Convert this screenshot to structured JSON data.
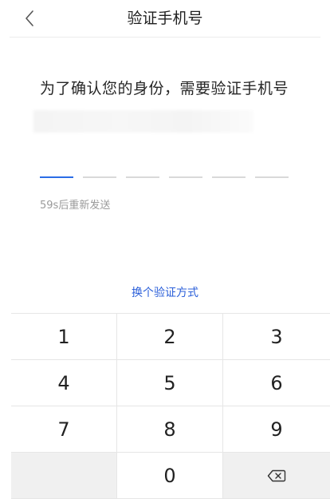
{
  "header": {
    "title": "验证手机号"
  },
  "verify": {
    "prompt": "为了确认您的身份，需要验证手机号",
    "countdown": "59s后重新发送",
    "code_length": 6,
    "active_index": 0
  },
  "switch_method": "换个验证方式",
  "keypad": {
    "keys": [
      "1",
      "2",
      "3",
      "4",
      "5",
      "6",
      "7",
      "8",
      "9",
      "",
      "0",
      "⌫"
    ]
  },
  "colors": {
    "accent": "#2b6de6",
    "link": "#2b5fd9",
    "muted": "#9a9a9a"
  }
}
